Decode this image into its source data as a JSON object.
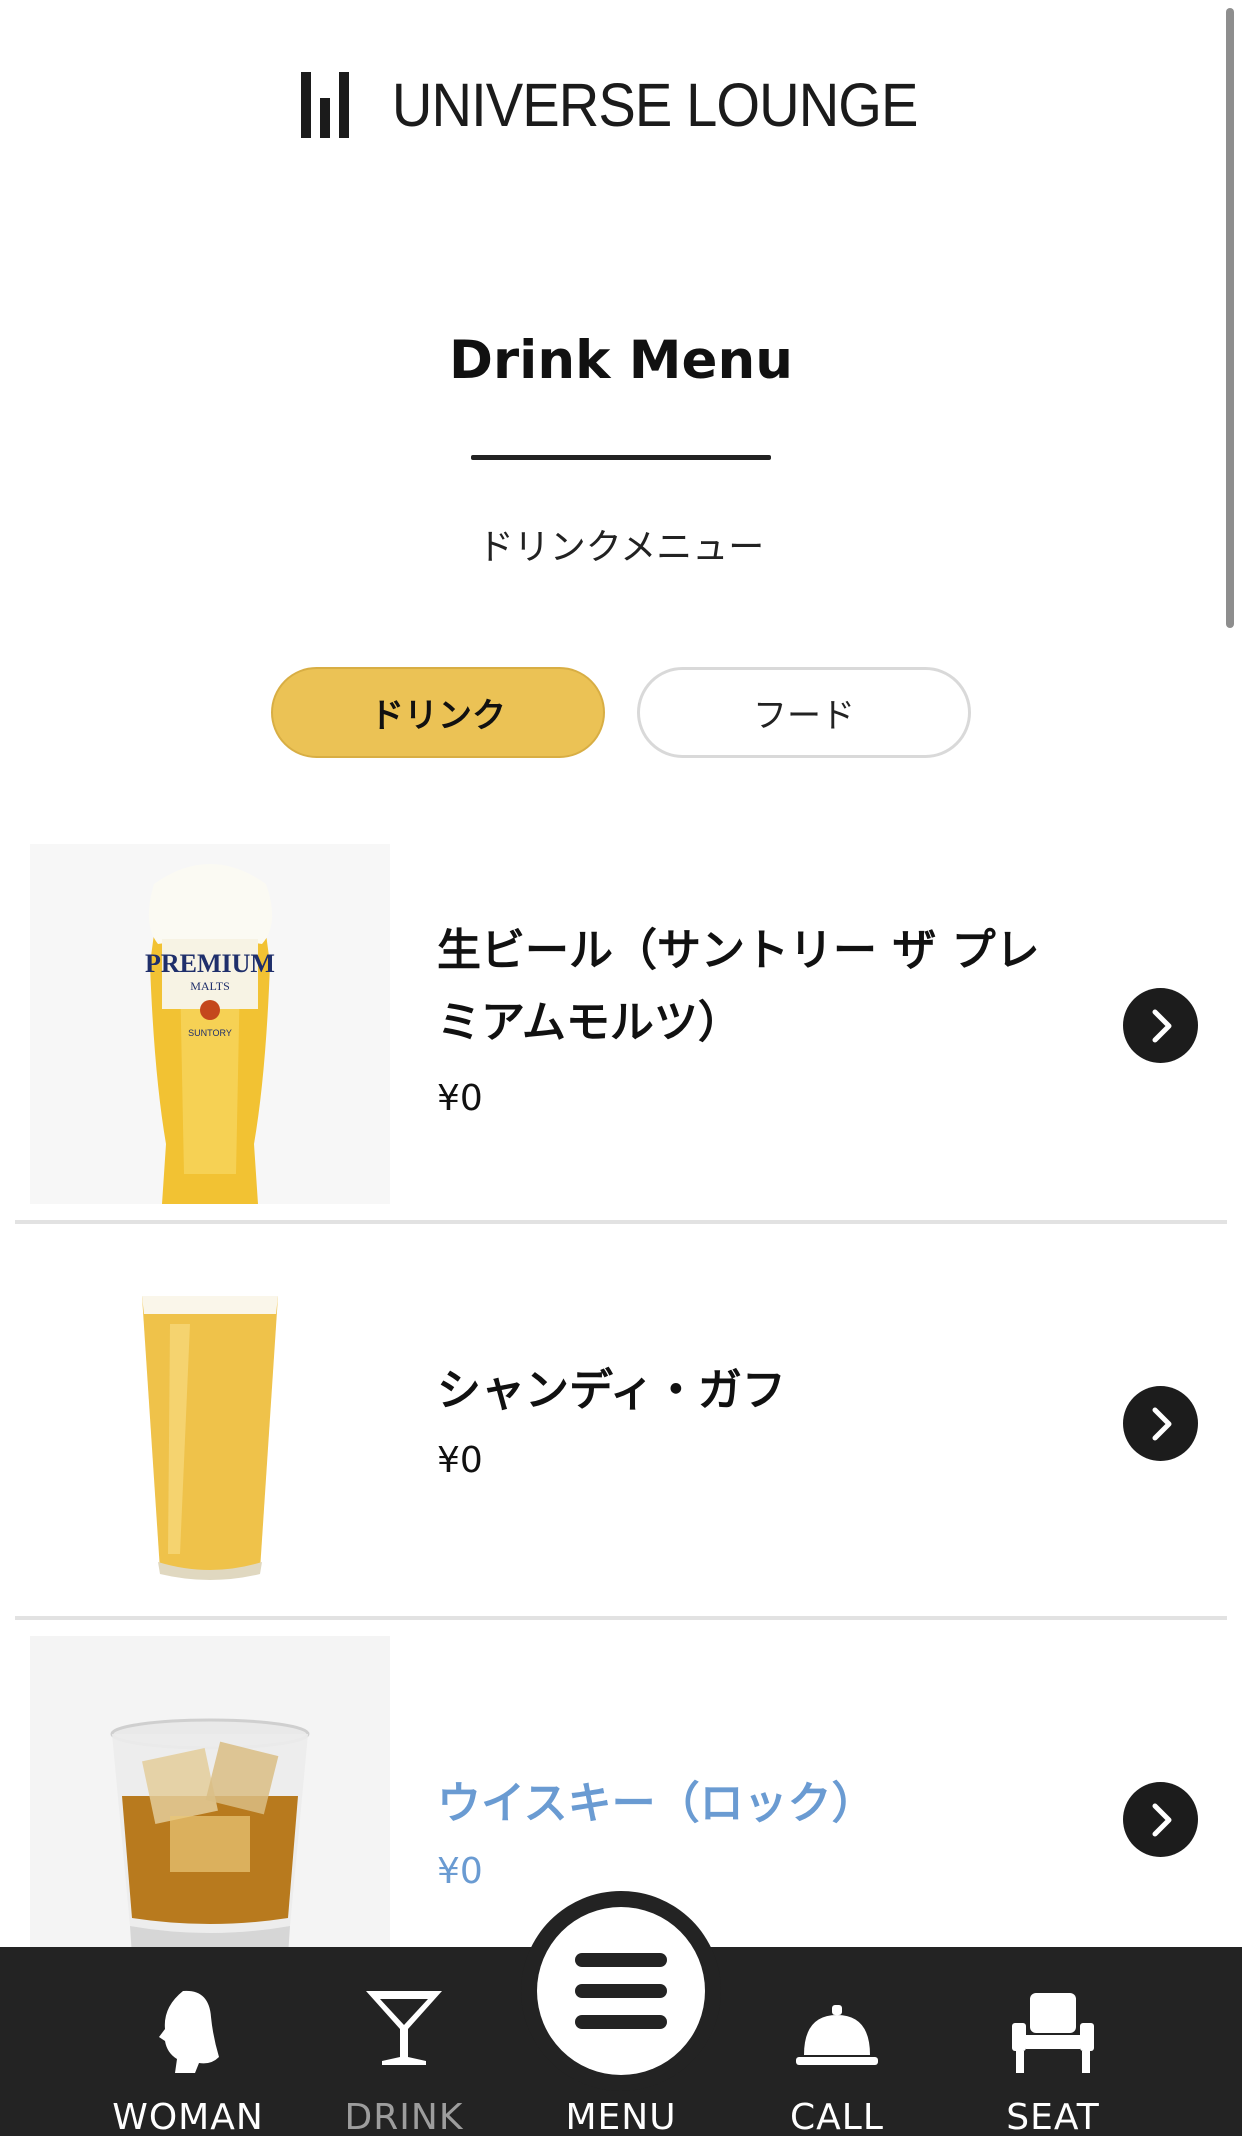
{
  "header": {
    "logo_text": "UNIVERSE LOUNGE",
    "title": "Drink Menu",
    "subtitle": "ドリンクメニュー"
  },
  "tabs": [
    {
      "label": "ドリンク",
      "active": true
    },
    {
      "label": "フード",
      "active": false
    }
  ],
  "items": [
    {
      "name": "生ビール（サントリー ザ プレミアムモルツ）",
      "price": "¥0",
      "image": "premium-malts-beer-glass"
    },
    {
      "name": "シャンディ・ガフ",
      "price": "¥0",
      "image": "shandy-gaff-glass"
    },
    {
      "name": "ウイスキー（ロック）",
      "price": "¥0",
      "image": "whisky-rock-glass"
    }
  ],
  "bottom_nav": [
    {
      "label": "WOMAN",
      "icon": "woman-icon"
    },
    {
      "label": "DRINK",
      "icon": "cocktail-glass-icon"
    },
    {
      "label": "MENU",
      "icon": "hamburger-menu-icon"
    },
    {
      "label": "CALL",
      "icon": "service-bell-icon"
    },
    {
      "label": "SEAT",
      "icon": "chair-icon"
    }
  ],
  "colors": {
    "accent": "#ebc255",
    "nav_background": "#232323",
    "link": "#6a9bd2",
    "inactive_nav_label": "#9d9d9d"
  }
}
